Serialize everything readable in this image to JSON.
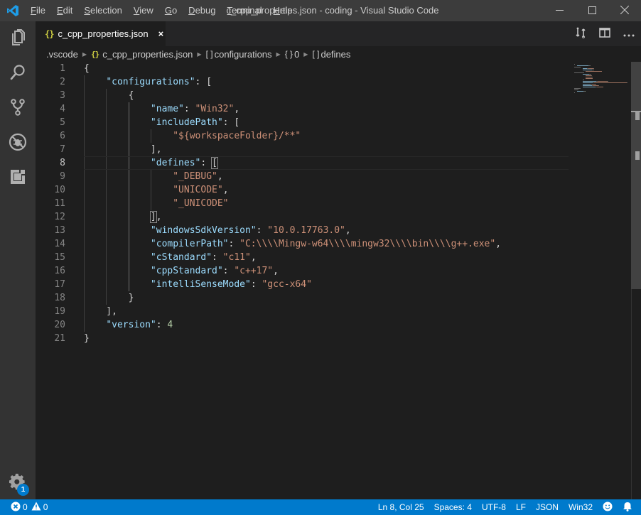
{
  "titlebar": {
    "window_title": "c_cpp_properties.json - coding - Visual Studio Code",
    "menu": [
      {
        "label": "File",
        "mnemonic": "F",
        "rest": "ile"
      },
      {
        "label": "Edit",
        "mnemonic": "E",
        "rest": "dit"
      },
      {
        "label": "Selection",
        "mnemonic": "S",
        "rest": "election"
      },
      {
        "label": "View",
        "mnemonic": "V",
        "rest": "iew"
      },
      {
        "label": "Go",
        "mnemonic": "G",
        "rest": "o"
      },
      {
        "label": "Debug",
        "mnemonic": "D",
        "rest": "ebug"
      },
      {
        "label": "Terminal",
        "mnemonic": "T",
        "rest": "erminal"
      },
      {
        "label": "Help",
        "mnemonic": "H",
        "rest": "elp"
      }
    ],
    "controls": [
      "minimize-icon",
      "maximize-icon",
      "close-icon"
    ]
  },
  "activitybar": {
    "items": [
      "explorer-icon",
      "search-icon",
      "source-control-icon",
      "debug-icon",
      "extensions-icon"
    ],
    "manage_badge": "1"
  },
  "tab": {
    "icon": "{}",
    "label": "c_cpp_properties.json",
    "close": "×"
  },
  "editor_actions": [
    "open-changes-icon",
    "split-editor-icon",
    "more-actions-icon"
  ],
  "breadcrumb": {
    "folder": ".vscode",
    "file_icon": "{}",
    "file": "c_cpp_properties.json",
    "items": [
      {
        "icon": "[ ]",
        "label": "configurations"
      },
      {
        "icon": "{ }",
        "label": "0"
      },
      {
        "icon": "[ ]",
        "label": "defines"
      }
    ]
  },
  "editor": {
    "active_line": 8,
    "lines": [
      {
        "n": "1",
        "tokens": [
          [
            "p",
            "{"
          ]
        ]
      },
      {
        "n": "2",
        "tokens": [
          [
            "p",
            "    "
          ],
          [
            "k",
            "\"configurations\""
          ],
          [
            "p",
            ": ["
          ]
        ]
      },
      {
        "n": "3",
        "tokens": [
          [
            "p",
            "        {"
          ]
        ]
      },
      {
        "n": "4",
        "tokens": [
          [
            "p",
            "            "
          ],
          [
            "k",
            "\"name\""
          ],
          [
            "p",
            ": "
          ],
          [
            "s",
            "\"Win32\""
          ],
          [
            "p",
            ","
          ]
        ]
      },
      {
        "n": "5",
        "tokens": [
          [
            "p",
            "            "
          ],
          [
            "k",
            "\"includePath\""
          ],
          [
            "p",
            ": ["
          ]
        ]
      },
      {
        "n": "6",
        "tokens": [
          [
            "p",
            "                "
          ],
          [
            "s",
            "\"${workspaceFolder}/**\""
          ]
        ]
      },
      {
        "n": "7",
        "tokens": [
          [
            "p",
            "            ],"
          ]
        ]
      },
      {
        "n": "8",
        "tokens": [
          [
            "p",
            "            "
          ],
          [
            "k",
            "\"defines\""
          ],
          [
            "p",
            ": "
          ],
          [
            "bm",
            "["
          ]
        ]
      },
      {
        "n": "9",
        "tokens": [
          [
            "p",
            "                "
          ],
          [
            "s",
            "\"_DEBUG\""
          ],
          [
            "p",
            ","
          ]
        ]
      },
      {
        "n": "10",
        "tokens": [
          [
            "p",
            "                "
          ],
          [
            "s",
            "\"UNICODE\""
          ],
          [
            "p",
            ","
          ]
        ]
      },
      {
        "n": "11",
        "tokens": [
          [
            "p",
            "                "
          ],
          [
            "s",
            "\"_UNICODE\""
          ]
        ]
      },
      {
        "n": "12",
        "tokens": [
          [
            "p",
            "            "
          ],
          [
            "bm",
            "]"
          ],
          [
            "p",
            ","
          ]
        ]
      },
      {
        "n": "13",
        "tokens": [
          [
            "p",
            "            "
          ],
          [
            "k",
            "\"windowsSdkVersion\""
          ],
          [
            "p",
            ": "
          ],
          [
            "s",
            "\"10.0.17763.0\""
          ],
          [
            "p",
            ","
          ]
        ]
      },
      {
        "n": "14",
        "tokens": [
          [
            "p",
            "            "
          ],
          [
            "k",
            "\"compilerPath\""
          ],
          [
            "p",
            ": "
          ],
          [
            "s",
            "\"C:\\\\\\\\Mingw-w64\\\\\\\\mingw32\\\\\\\\bin\\\\\\\\g++.exe\""
          ],
          [
            "p",
            ","
          ]
        ]
      },
      {
        "n": "15",
        "tokens": [
          [
            "p",
            "            "
          ],
          [
            "k",
            "\"cStandard\""
          ],
          [
            "p",
            ": "
          ],
          [
            "s",
            "\"c11\""
          ],
          [
            "p",
            ","
          ]
        ]
      },
      {
        "n": "16",
        "tokens": [
          [
            "p",
            "            "
          ],
          [
            "k",
            "\"cppStandard\""
          ],
          [
            "p",
            ": "
          ],
          [
            "s",
            "\"c++17\""
          ],
          [
            "p",
            ","
          ]
        ]
      },
      {
        "n": "17",
        "tokens": [
          [
            "p",
            "            "
          ],
          [
            "k",
            "\"intelliSenseMode\""
          ],
          [
            "p",
            ": "
          ],
          [
            "s",
            "\"gcc-x64\""
          ]
        ]
      },
      {
        "n": "18",
        "tokens": [
          [
            "p",
            "        }"
          ]
        ]
      },
      {
        "n": "19",
        "tokens": [
          [
            "p",
            "    ],"
          ]
        ]
      },
      {
        "n": "20",
        "tokens": [
          [
            "p",
            "    "
          ],
          [
            "k",
            "\"version\""
          ],
          [
            "p",
            ": "
          ],
          [
            "n",
            "4"
          ]
        ]
      },
      {
        "n": "21",
        "tokens": [
          [
            "p",
            "}"
          ]
        ]
      }
    ]
  },
  "statusbar": {
    "errors": "0",
    "warnings": "0",
    "cursor": "Ln 8, Col 25",
    "indent": "Spaces: 4",
    "encoding": "UTF-8",
    "eol": "LF",
    "language": "JSON",
    "config": "Win32"
  },
  "colors": {
    "statusbar": "#007acc",
    "key": "#9cdcfe",
    "string": "#ce9178",
    "number": "#b5cea8",
    "json_icon": "#cbcb41"
  }
}
